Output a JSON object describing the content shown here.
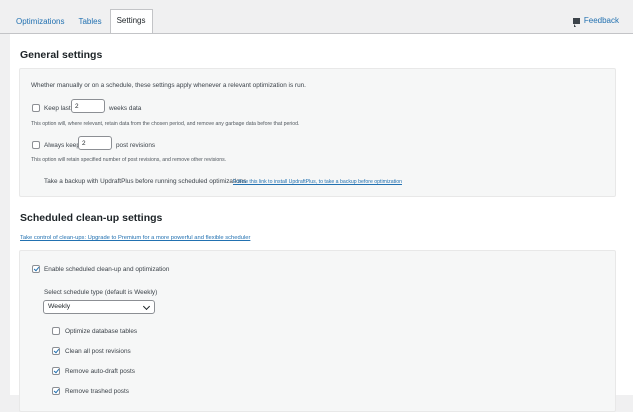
{
  "tabs": [
    {
      "label": "Optimizations"
    },
    {
      "label": "Tables"
    },
    {
      "label": "Settings"
    }
  ],
  "feedback": {
    "label": "Feedback"
  },
  "general": {
    "title": "General settings",
    "intro": "Whether manually or on a schedule, these settings apply whenever a relevant optimization is run.",
    "keep_last": {
      "checked": false,
      "label_before": "Keep last",
      "value": "2",
      "label_after": "weeks data",
      "help": "This option will, where relevant, retain data from the chosen period, and remove any garbage data before that period."
    },
    "always_keep": {
      "checked": false,
      "label_before": "Always keep",
      "value": "2",
      "label_after": "post revisions",
      "help": "This option will retain specified number of post revisions, and remove other revisions."
    },
    "backup_text": "Take a backup with UpdraftPlus before running scheduled optimizations",
    "backup_link": "Follow this link to install UpdraftPlus, to take a backup before optimization"
  },
  "scheduled": {
    "title": "Scheduled clean-up settings",
    "premium_link": "Take control of clean-ups: Upgrade to Premium for a more powerful and flexible scheduler",
    "enable_label": "Enable scheduled clean-up and optimization",
    "enable_checked": true,
    "schedule_type_label": "Select schedule type (default is Weekly)",
    "schedule_type_value": "Weekly",
    "options": [
      {
        "label": "Optimize database tables",
        "checked": false
      },
      {
        "label": "Clean all post revisions",
        "checked": true
      },
      {
        "label": "Remove auto-draft posts",
        "checked": true
      },
      {
        "label": "Remove trashed posts",
        "checked": true
      }
    ]
  },
  "colors": {
    "accent": "#2271b1",
    "background": "#f0f0f1",
    "panel": "#f6f7f7"
  },
  "icons": {
    "feedback": "feedback-flag-icon",
    "checkbox": "check-icon",
    "select": "chevron-down-icon"
  }
}
